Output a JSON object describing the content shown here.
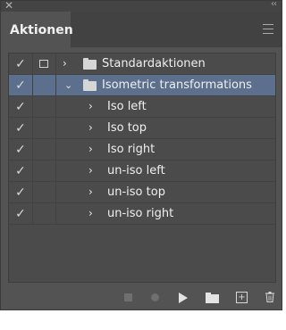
{
  "panel": {
    "close_glyph": "✕",
    "collapse_glyph": "‹‹",
    "tab_label": "Aktionen",
    "menu_icon": "hamburger-menu-icon"
  },
  "actions": [
    {
      "label": "Standardaktionen",
      "type": "set",
      "expanded": false,
      "checked": true,
      "dialog": true,
      "selected": false
    },
    {
      "label": "Isometric transformations",
      "type": "set",
      "expanded": true,
      "checked": true,
      "dialog": false,
      "selected": true
    },
    {
      "label": "Iso left",
      "type": "action",
      "checked": true
    },
    {
      "label": "Iso top",
      "type": "action",
      "checked": true
    },
    {
      "label": "Iso right",
      "type": "action",
      "checked": true
    },
    {
      "label": "un-iso left",
      "type": "action",
      "checked": true
    },
    {
      "label": "un-iso top",
      "type": "action",
      "checked": true
    },
    {
      "label": "un-iso right",
      "type": "action",
      "checked": true
    }
  ],
  "glyphs": {
    "check": "✓",
    "chevron_right": "›",
    "chevron_down": "⌄",
    "plus": "+"
  },
  "toolbar": {
    "icons": [
      "stop-icon",
      "record-icon",
      "play-icon",
      "new-set-folder-icon",
      "new-action-icon",
      "trash-icon"
    ]
  },
  "colors": {
    "panel_bg": "#535353",
    "list_bg": "#4b4b4b",
    "selected_row": "#5c6f8c",
    "text": "#efefef"
  }
}
